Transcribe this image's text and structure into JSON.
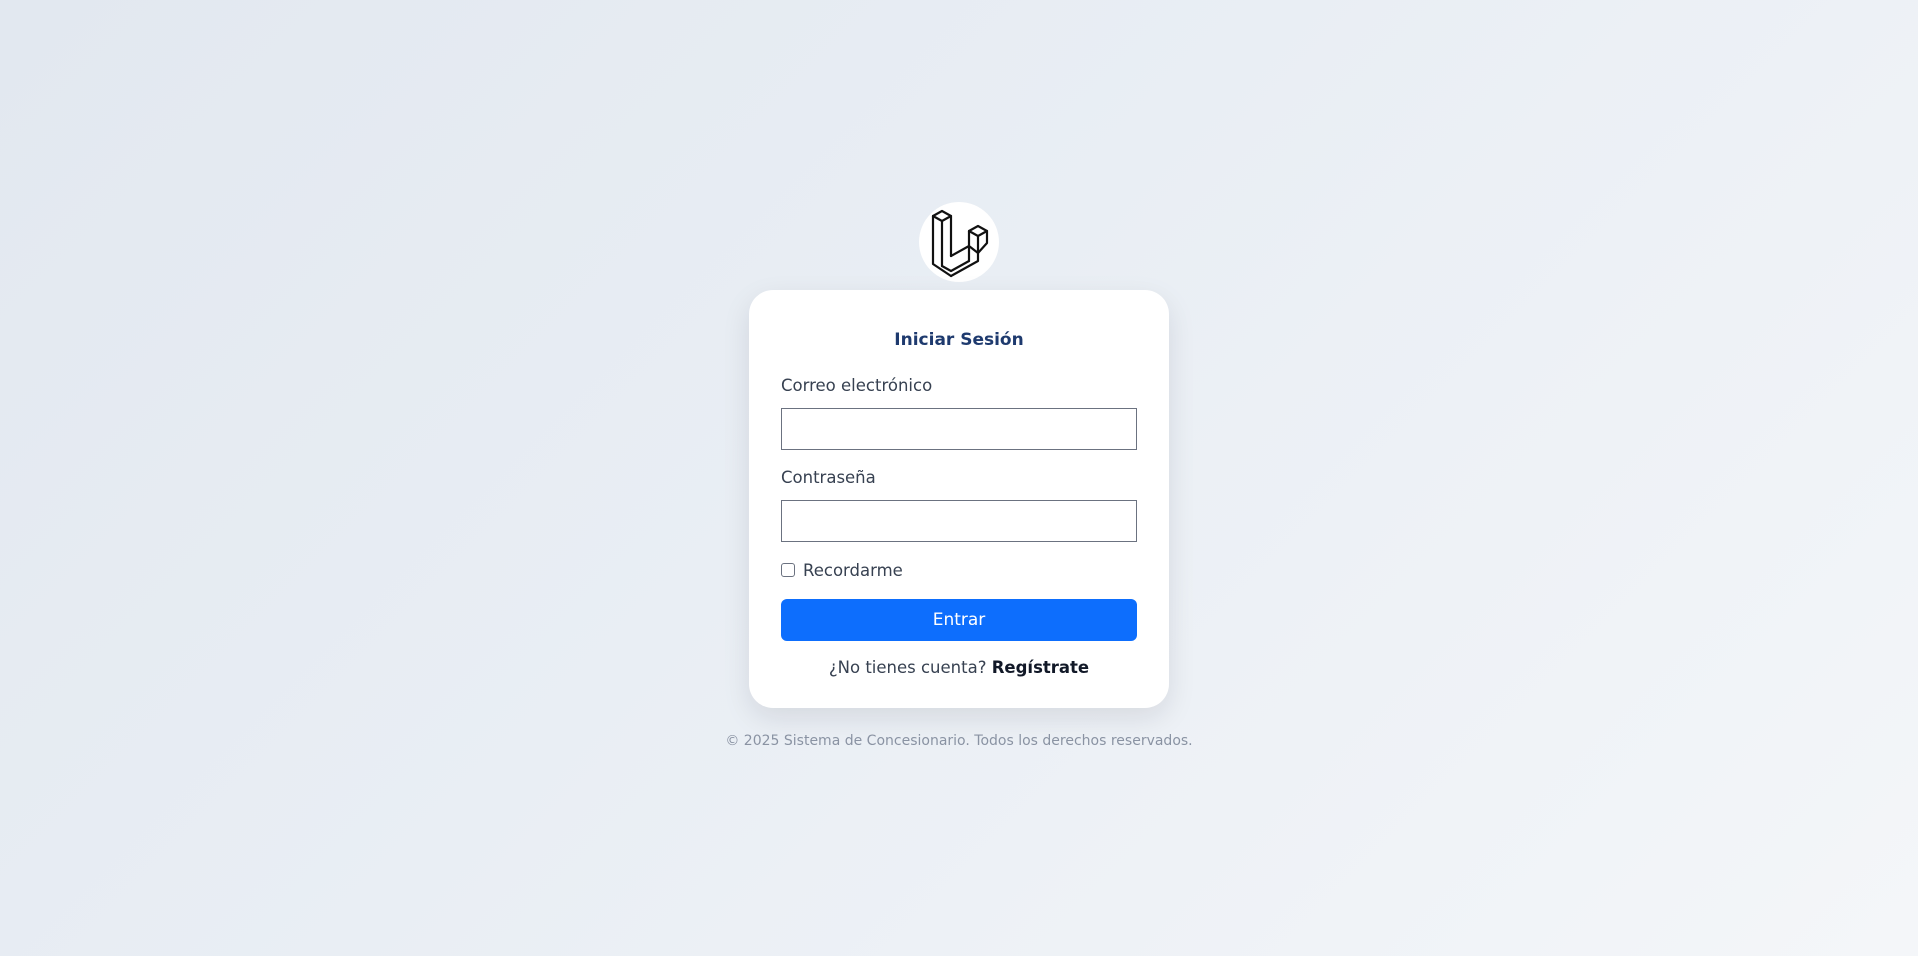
{
  "logo": {
    "icon": "laravel-logo-icon"
  },
  "login": {
    "title": "Iniciar Sesión",
    "email_label": "Correo electrónico",
    "email_value": "",
    "password_label": "Contraseña",
    "password_value": "",
    "remember_label": "Recordarme",
    "remember_checked": false,
    "submit_label": "Entrar",
    "register_prompt": "¿No tienes cuenta?",
    "register_link": "Regístrate"
  },
  "footer": {
    "text": "© 2025 Sistema de Concesionario. Todos los derechos reservados."
  },
  "colors": {
    "accent": "#0d6efd",
    "title": "#1e3a6e",
    "card": "#ffffff"
  }
}
